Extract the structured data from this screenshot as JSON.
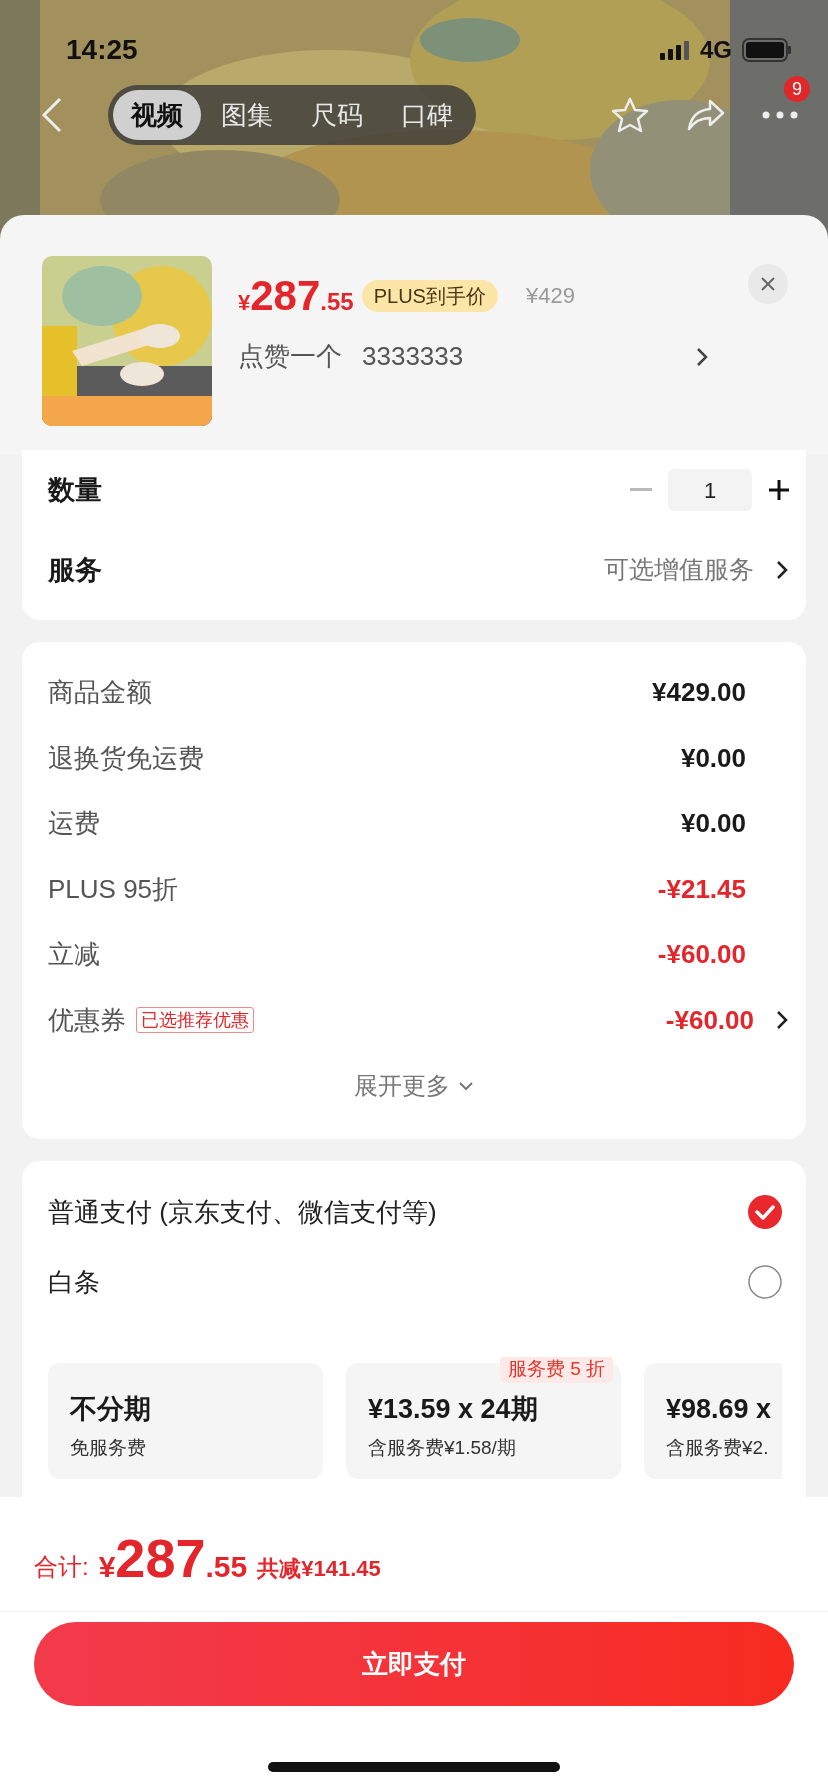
{
  "status_bar": {
    "time": "14:25",
    "network": "4G"
  },
  "nav": {
    "tabs": [
      {
        "label": "视频",
        "selected": true
      },
      {
        "label": "图集",
        "selected": false
      },
      {
        "label": "尺码",
        "selected": false
      },
      {
        "label": "口碑",
        "selected": false
      }
    ],
    "badge": "9"
  },
  "product": {
    "currency": "¥",
    "price_int": "287",
    "price_dec": ".55",
    "plus_badge": "PLUS到手价",
    "original_price": "¥429",
    "spec": [
      "点赞一个",
      "3333333"
    ]
  },
  "options": {
    "quantity": {
      "label": "数量",
      "value": "1"
    },
    "service": {
      "label": "服务",
      "value": "可选增值服务"
    }
  },
  "price_rows": [
    {
      "label": "商品金额",
      "value": "¥429.00",
      "kind": "normal",
      "chevron": false
    },
    {
      "label": "退换货免运费",
      "value": "¥0.00",
      "kind": "normal",
      "chevron": false
    },
    {
      "label": "运费",
      "value": "¥0.00",
      "kind": "normal",
      "chevron": false
    },
    {
      "label": "PLUS 95折",
      "value": "-¥21.45",
      "kind": "discount",
      "chevron": false
    },
    {
      "label": "立减",
      "value": "-¥60.00",
      "kind": "discount",
      "chevron": false
    },
    {
      "label": "优惠券",
      "tag": "已选推荐优惠",
      "value": "-¥60.00",
      "kind": "discount",
      "chevron": true
    }
  ],
  "expand": "展开更多",
  "payment": {
    "methods": [
      {
        "label": "普通支付 (京东支付、微信支付等)",
        "selected": true
      },
      {
        "label": "白条",
        "selected": false
      }
    ],
    "plans": [
      {
        "title": "不分期",
        "subtitle": "免服务费"
      },
      {
        "title": "¥13.59 x 24期",
        "subtitle": "含服务费¥1.58/期",
        "tag": "服务费 5 折"
      },
      {
        "title": "¥98.69 x",
        "subtitle": "含服务费¥2."
      }
    ]
  },
  "total": {
    "label": "合计:",
    "currency": "¥",
    "int": "287",
    "dec": ".55",
    "saving": "共减¥141.45"
  },
  "pay_button": "立即支付"
}
